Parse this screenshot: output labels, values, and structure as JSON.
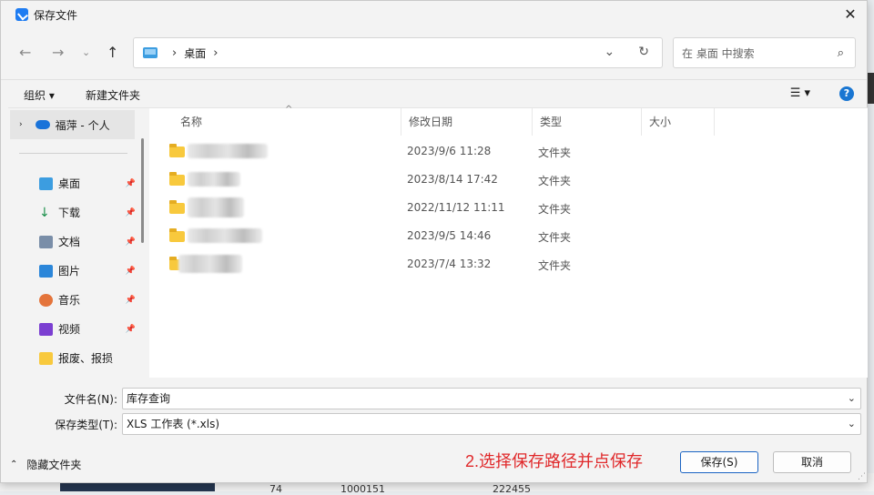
{
  "window": {
    "title": "保存文件"
  },
  "address": {
    "location": "桌面",
    "search_placeholder": "在 桌面 中搜索"
  },
  "toolbar": {
    "organize": "组织",
    "new_folder": "新建文件夹"
  },
  "sidebar": {
    "cloud_item": "福萍 - 个人",
    "items": [
      {
        "label": "桌面",
        "icon": "desktop-icon"
      },
      {
        "label": "下载",
        "icon": "download-icon"
      },
      {
        "label": "文档",
        "icon": "document-icon"
      },
      {
        "label": "图片",
        "icon": "picture-icon"
      },
      {
        "label": "音乐",
        "icon": "music-icon"
      },
      {
        "label": "视频",
        "icon": "video-icon"
      },
      {
        "label": "报废、报损",
        "icon": "folder-icon"
      }
    ]
  },
  "file_list": {
    "columns": [
      "名称",
      "修改日期",
      "类型",
      "大小"
    ],
    "rows": [
      {
        "date": "2023/9/6 11:28",
        "type": "文件夹"
      },
      {
        "date": "2023/8/14 17:42",
        "type": "文件夹"
      },
      {
        "date": "2022/11/12 11:11",
        "type": "文件夹"
      },
      {
        "date": "2023/9/5 14:46",
        "type": "文件夹"
      },
      {
        "date": "2023/7/4 13:32",
        "type": "文件夹"
      }
    ]
  },
  "form": {
    "filename_label": "文件名(N):",
    "filename_value": "库存查询",
    "filetype_label": "保存类型(T):",
    "filetype_value": "XLS 工作表 (*.xls)"
  },
  "footer": {
    "hide_folders": "隐藏文件夹",
    "instruction": "2.选择保存路径并点保存",
    "save": "保存(S)",
    "cancel": "取消"
  },
  "background": {
    "cells": [
      "74",
      "1000151",
      "222455"
    ]
  },
  "colors": {
    "accent": "#1a63c2",
    "instruction": "#e0282a",
    "folder": "#f8c93d"
  }
}
